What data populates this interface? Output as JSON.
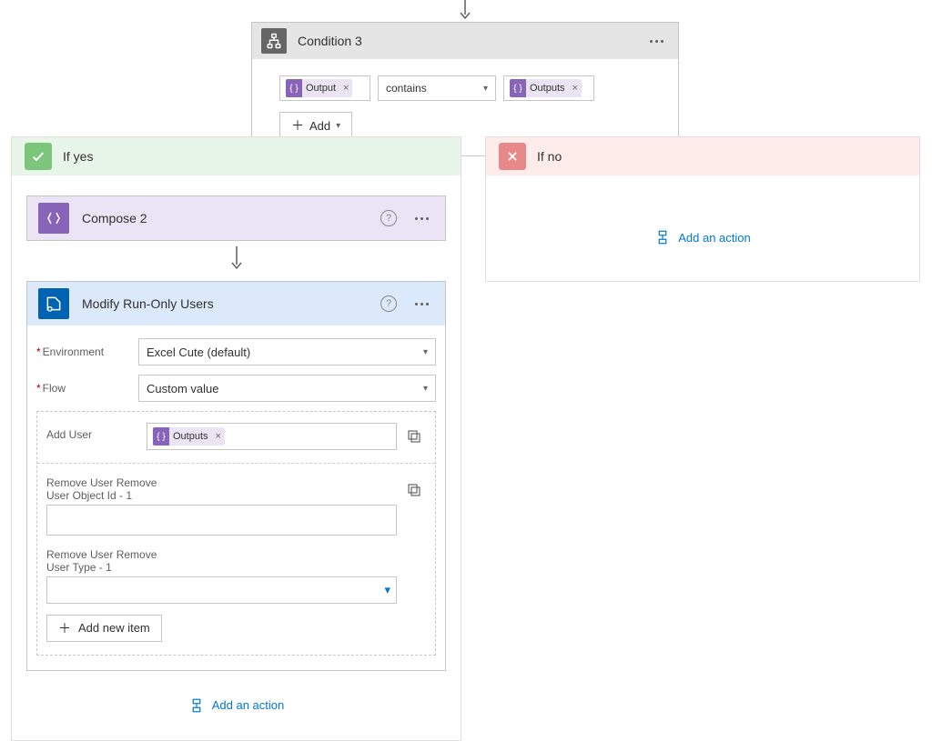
{
  "condition": {
    "title": "Condition 3",
    "left_token": "Output",
    "operator": "contains",
    "right_token": "Outputs",
    "add_label": "Add"
  },
  "branches": {
    "yes_label": "If yes",
    "no_label": "If no",
    "add_action": "Add an action"
  },
  "compose": {
    "title": "Compose 2"
  },
  "modify": {
    "title": "Modify Run-Only Users",
    "environment_label": "Environment",
    "environment_value": "Excel Cute (default)",
    "flow_label": "Flow",
    "flow_value": "Custom value",
    "add_user_label": "Add User",
    "add_user_token": "Outputs",
    "remove_user_obj_label": "Remove User Remove User Object Id - 1",
    "remove_user_type_label": "Remove User Remove User Type - 1",
    "add_new_item": "Add new item"
  }
}
